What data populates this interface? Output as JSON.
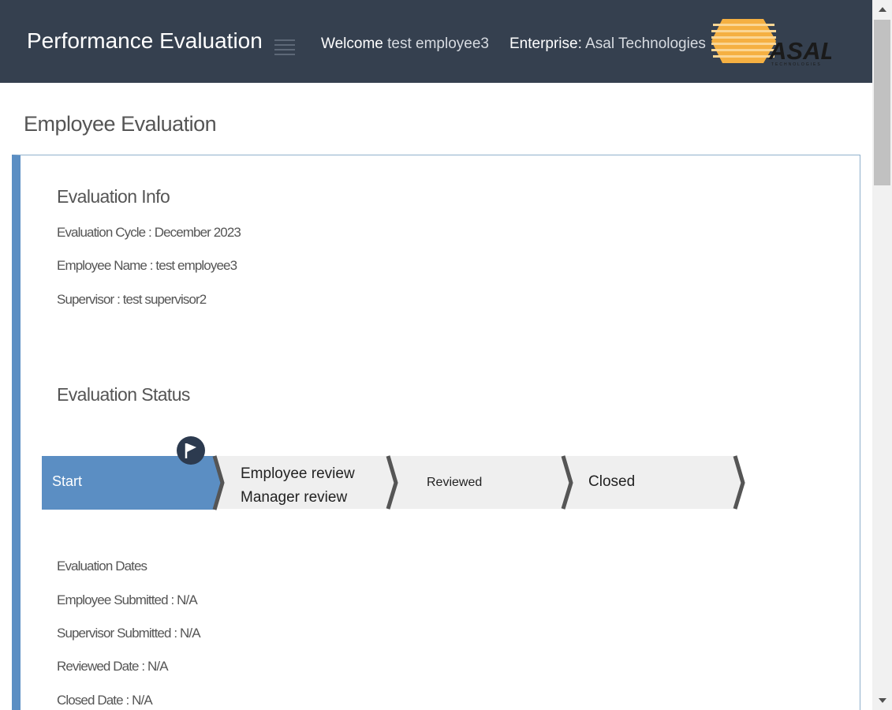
{
  "header": {
    "app_title": "Performance Evaluation",
    "welcome_label": "Welcome",
    "welcome_user": "test employee3",
    "enterprise_label": "Enterprise:",
    "enterprise_name": "Asal Technologies",
    "logo_text": "ASAL",
    "logo_subtext": "TECHNOLOGIES",
    "menu_icon": "hamburger-menu-icon"
  },
  "page": {
    "title": "Employee Evaluation"
  },
  "evaluation_info": {
    "title": "Evaluation Info",
    "cycle": "Evaluation Cycle : December 2023",
    "employee": "Employee Name : test employee3",
    "supervisor": "Supervisor : test supervisor2"
  },
  "evaluation_status": {
    "title": "Evaluation Status",
    "steps": [
      {
        "label": "Start",
        "active": true
      },
      {
        "label": "Employee review",
        "label2": "Manager review",
        "active": false
      },
      {
        "label": "Reviewed",
        "active": false
      },
      {
        "label": "Closed",
        "active": false
      }
    ],
    "current_marker_icon": "flag-icon"
  },
  "evaluation_dates": {
    "title": "Evaluation Dates",
    "employee_submitted": "Employee Submitted : N/A",
    "supervisor_submitted": "Supervisor Submitted : N/A",
    "reviewed_date": "Reviewed Date : N/A",
    "closed_date": "Closed Date : N/A"
  },
  "colors": {
    "header_bg": "#35404f",
    "accent": "#5b8ec3",
    "step_inactive": "#efefef",
    "logo_orange": "#f5b042"
  }
}
